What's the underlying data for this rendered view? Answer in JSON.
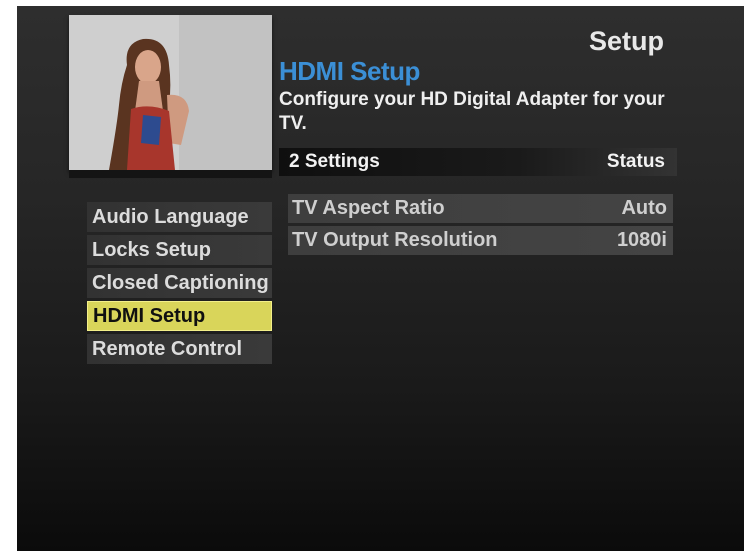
{
  "screen": {
    "title": "Setup"
  },
  "section": {
    "title": "HDMI Setup",
    "description": "Configure your HD Digital Adapter for your TV."
  },
  "settings_header": {
    "count_label": "2 Settings",
    "status_label": "Status"
  },
  "menu": {
    "items": [
      {
        "label": "Audio Language",
        "selected": false
      },
      {
        "label": "Locks Setup",
        "selected": false
      },
      {
        "label": "Closed Captioning",
        "selected": false
      },
      {
        "label": "HDMI Setup",
        "selected": true
      },
      {
        "label": "Remote Control",
        "selected": false
      }
    ]
  },
  "settings": [
    {
      "name": "TV Aspect Ratio",
      "value": "Auto"
    },
    {
      "name": "TV Output Resolution",
      "value": "1080i"
    }
  ],
  "colors": {
    "accent_blue": "#3b8fd6",
    "selected_highlight": "#d9d55a"
  }
}
